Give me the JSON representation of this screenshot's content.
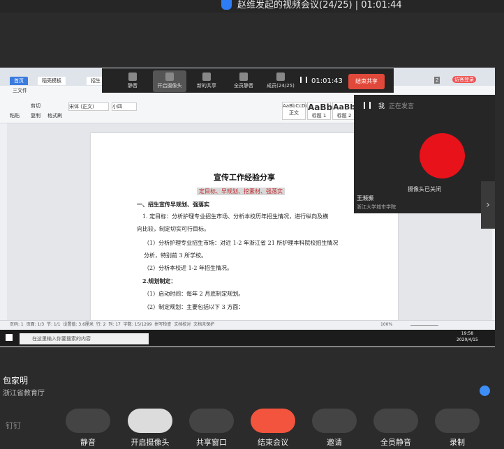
{
  "top_bar": {
    "title": "赵维发起的视频会议(24/25) | 01:01:44"
  },
  "wps": {
    "tabs": [
      "首页",
      "稻壳模板",
      "招生"
    ],
    "menu": [
      "三文件"
    ],
    "font_name": "宋体 (正文)",
    "font_size": "小四",
    "styles": [
      "AaBbCcDd",
      "AaBb",
      "AaBb"
    ],
    "style_labels": [
      "正文",
      "标题 1",
      "标题 2"
    ],
    "ribbon_labels": [
      "粘贴",
      "剪切",
      "复制",
      "格式刷"
    ],
    "right_label": "访客登录",
    "right_badge": "2"
  },
  "document": {
    "title": "宣传工作经验分享",
    "subtitle": "定目标、早规划、挖素材、强落实",
    "lines": [
      "一、招生宣传早规划、强落实",
      "1. 定目标：分析护理专业招生市场、分析本校历年招生情况，进行纵向及横",
      "向比较，制定切实可行目标。",
      "（1）分析护理专业招生市场：对近 1-2 年浙江省 21 所护理本科院校招生情况",
      "分析，特别前 3 所学校。",
      "（2）分析本校近 1-2 年招生情况。",
      "2.规划制定：",
      "（1）启动时间：每年 2 月底制定规划。",
      "（2）制定规划：主要包括以下 3 方面："
    ],
    "red_text": "2 月底"
  },
  "status_bar": {
    "items": [
      "页码: 1",
      "页面: 1/3",
      "节: 1/1",
      "设置值: 3.6厘米",
      "行: 2",
      "列: 17",
      "字数: 15/1299",
      "拼写检查",
      "文档校对",
      "文档未保护"
    ],
    "zoom": "100%"
  },
  "taskbar": {
    "search_placeholder": "在这里输入你要搜索的内容",
    "time": "19:58",
    "date": "2020/4/15"
  },
  "meeting_toolbar": {
    "items": [
      "静音",
      "开启摄像头",
      "新的共享",
      "全员静音",
      "成员(24/25)"
    ],
    "timer": "01:01:43",
    "end_share": "结束共享"
  },
  "speaker_panel": {
    "header_name": "我",
    "header_status": "正在发言",
    "camera_off": "摄像头已关闭",
    "name": "王濒濒",
    "org": "浙江大学城市学院"
  },
  "presenter": {
    "name": "包家明",
    "org": "浙江省教育厅"
  },
  "bottom_bar": {
    "logo": "钉钉",
    "buttons": [
      "静音",
      "开启摄像头",
      "共享窗口",
      "结束会议",
      "邀请",
      "全员静音",
      "录制"
    ]
  },
  "colors": {
    "end_red": "#f2543d",
    "accent_blue": "#2f7df6",
    "doc_red": "#c0272d"
  }
}
